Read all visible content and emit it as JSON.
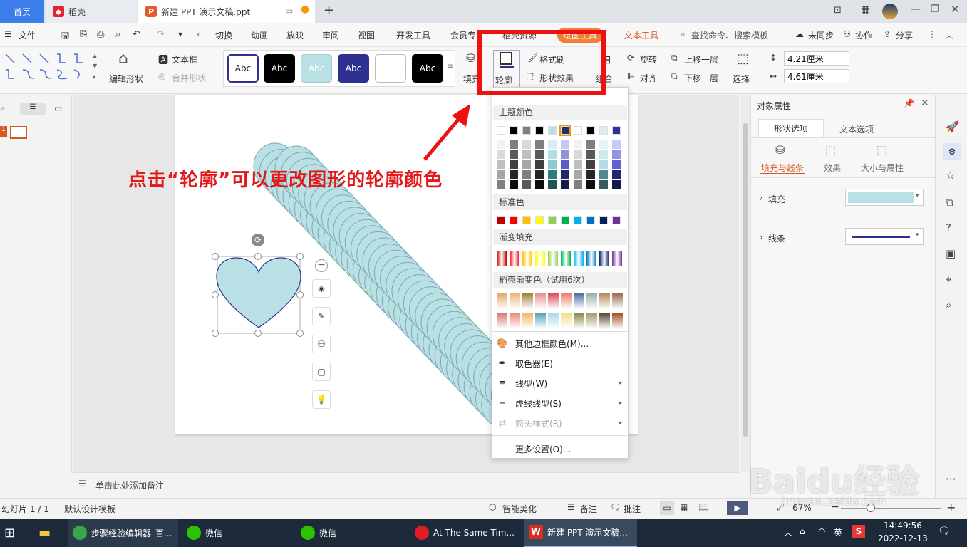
{
  "tabs": {
    "home": "首页",
    "daoke": "稻壳",
    "doc": "新建 PPT 演示文稿.ppt"
  },
  "menu": {
    "file": "文件",
    "items": [
      "切换",
      "动画",
      "放映",
      "审阅",
      "视图",
      "开发工具",
      "会员专",
      "稻壳资源",
      "绘图工具",
      "文本工具"
    ],
    "search": "查找命令、搜索模板",
    "unsync": "未同步",
    "collab": "协作",
    "share": "分享"
  },
  "toolbar": {
    "edit_shape": "编辑形状",
    "text_box": "文本框",
    "merge_shape": "合并形状",
    "styles": [
      "Abc",
      "Abc",
      "Abc",
      "Abc",
      "",
      "Abc"
    ],
    "fill": "填充",
    "outline": "轮廓",
    "format_painter": "格式刷",
    "shape_effect": "形状效果",
    "group": "组合",
    "rotate": "旋转",
    "align": "对齐",
    "bring_forward": "上移一层",
    "send_backward": "下移一层",
    "select": "选择",
    "height": "4.21厘米",
    "width": "4.61厘米"
  },
  "annotation": "点击“轮廓”可以更改图形的轮廓颜色",
  "dropdown": {
    "theme_colors": "主题颜色",
    "standard_colors": "标准色",
    "gradient_fill": "渐变填充",
    "daoke_gradient": "稻壳渐变色（试用6次）",
    "more_colors": "其他边框颜色(M)...",
    "eyedropper": "取色器(E)",
    "line_type": "线型(W)",
    "dash_type": "虚线线型(S)",
    "arrow_style": "箭头样式(R)",
    "more_settings": "更多设置(O)...",
    "theme_row": [
      "#ffffff",
      "#000000",
      "#7f7f7f",
      "#000000",
      "#b8dfe3",
      "#1f2d7a",
      "#ffffff",
      "#000000",
      "#d9eef0",
      "#2e3192"
    ],
    "standard_row": [
      "#c00000",
      "#ff0000",
      "#ffc000",
      "#ffff00",
      "#92d050",
      "#00b050",
      "#00b0f0",
      "#0070c0",
      "#002060",
      "#7030a0"
    ]
  },
  "notes": "单击此处添加备注",
  "status": {
    "slide": "幻灯片 1 / 1",
    "template": "默认设计模板",
    "beautify": "智能美化",
    "notes": "备注",
    "comment": "批注",
    "zoom": "67%"
  },
  "right_panel": {
    "title": "对象属性",
    "tab_shape": "形状选项",
    "tab_text": "文本选项",
    "sub_fill": "填充与线条",
    "sub_effect": "效果",
    "sub_size": "大小与属性",
    "fill": "填充",
    "line": "线条",
    "fill_color": "#b9e0e4",
    "line_color": "#2e3192"
  },
  "taskbar": {
    "items": [
      "步骤经验编辑器_百...",
      "微信",
      "微信",
      "At The Same Tim...",
      "新建 PPT 演示文稿..."
    ],
    "ime": "英",
    "time": "14:49:56",
    "date": "2022-12-13"
  },
  "watermark": "Baidu经验",
  "watermark_url": "jingyan.baidu.com"
}
